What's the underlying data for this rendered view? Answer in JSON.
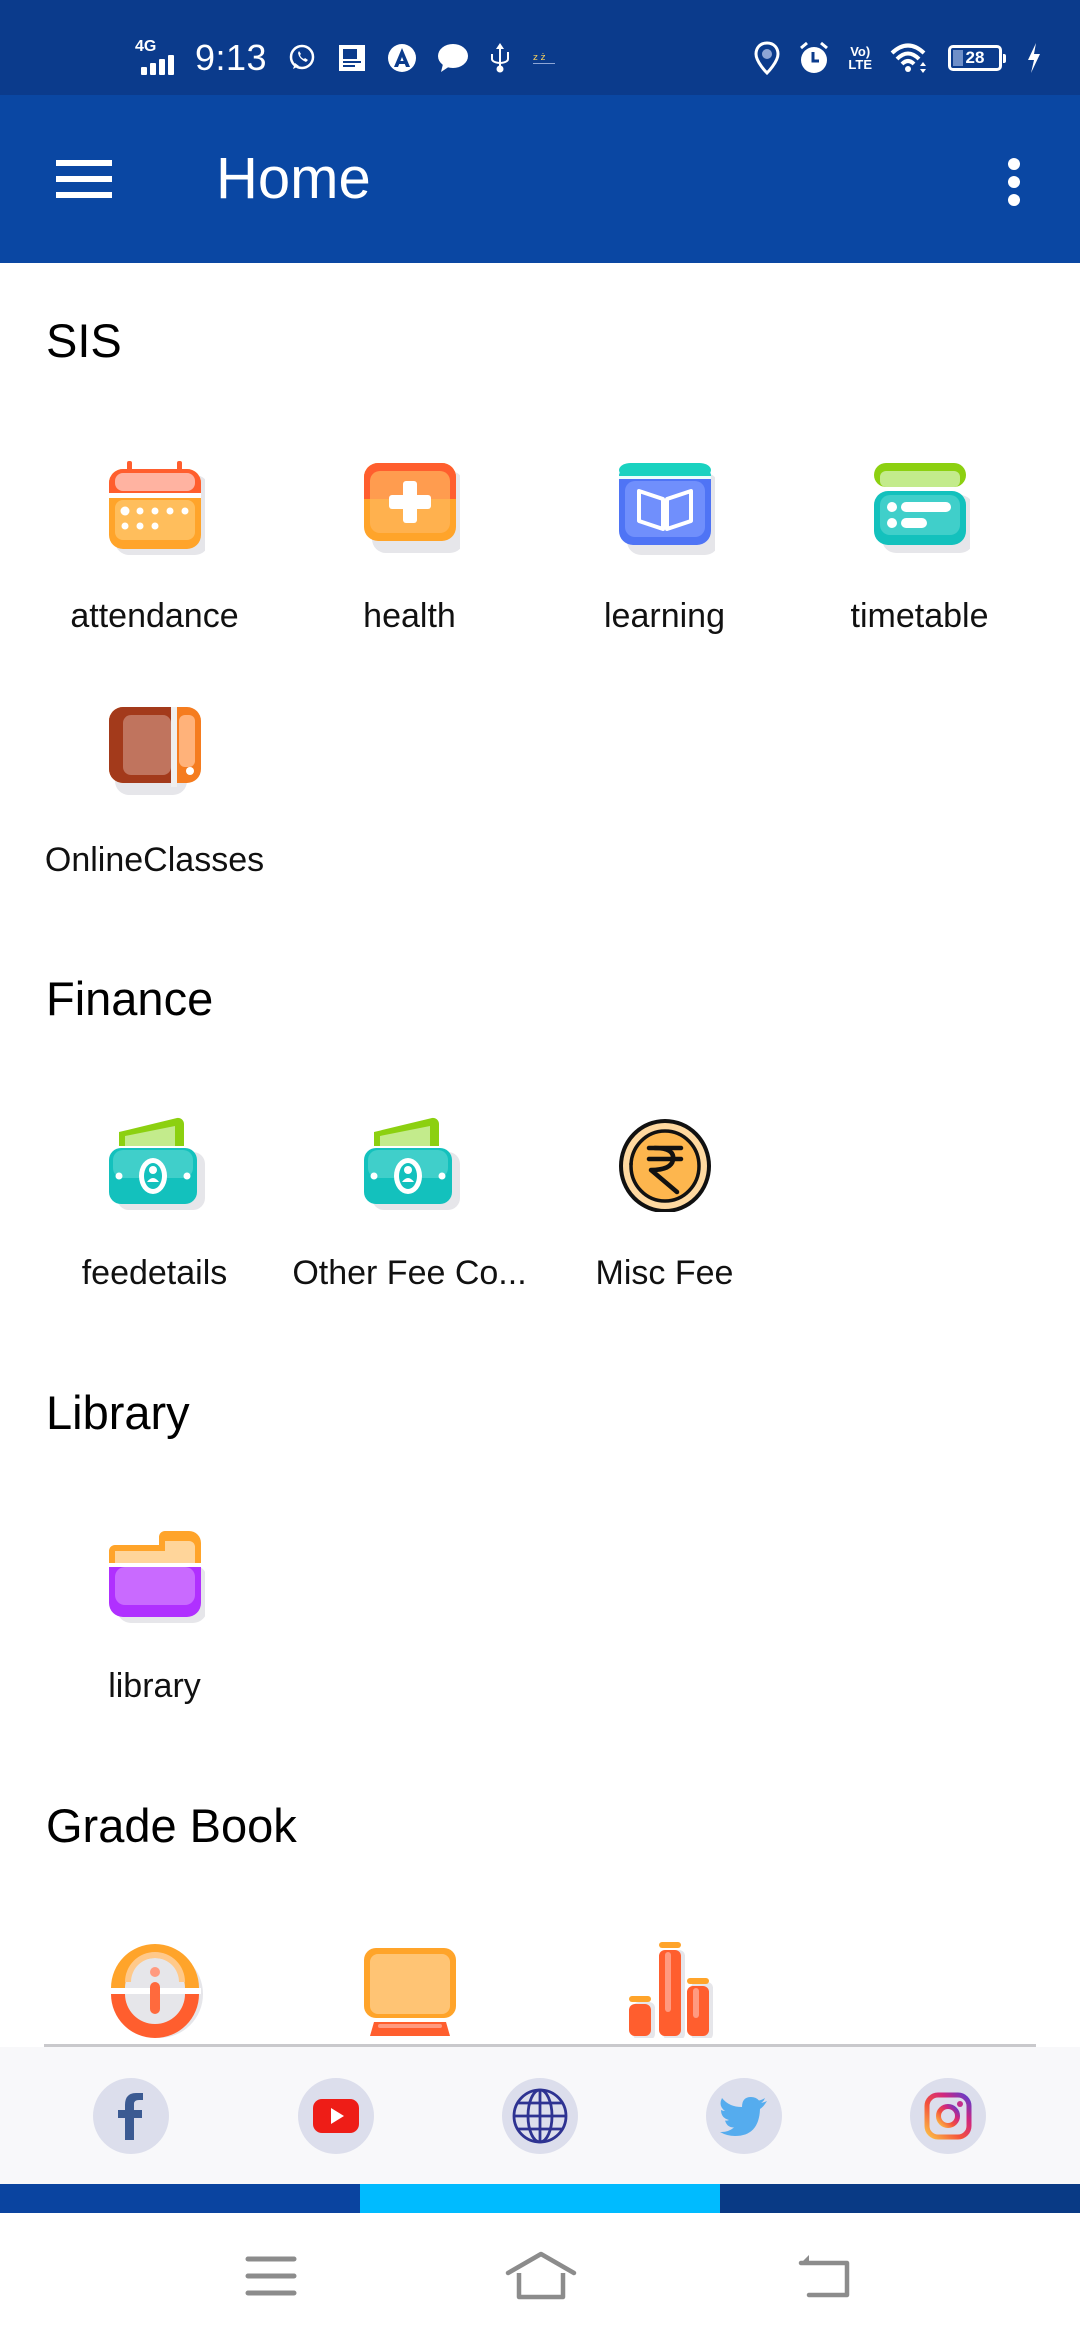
{
  "status_bar": {
    "network": "4G",
    "time": "9:13",
    "battery_level": "28",
    "notification_icons": [
      "whatsapp-icon",
      "document-icon",
      "app-a-icon",
      "message-icon",
      "usb-icon",
      "misc-icon"
    ],
    "system_icons": [
      "location-icon",
      "alarm-icon",
      "volte-icon",
      "wifi-icon",
      "battery-icon",
      "charging-icon"
    ],
    "volte_top": "Vo)",
    "volte_bottom": "LTE"
  },
  "app_bar": {
    "title": "Home",
    "menu_icon": "hamburger-menu-icon",
    "overflow_icon": "more-vert-icon"
  },
  "sections": [
    {
      "title": "SIS",
      "items": [
        {
          "label": "attendance",
          "icon": "calendar-icon"
        },
        {
          "label": "health",
          "icon": "medical-kit-icon"
        },
        {
          "label": "learning",
          "icon": "open-book-icon"
        },
        {
          "label": "timetable",
          "icon": "schedule-list-icon"
        },
        {
          "label": "OnlineClasses",
          "icon": "tablet-icon"
        }
      ]
    },
    {
      "title": "Finance",
      "items": [
        {
          "label": "feedetails",
          "icon": "money-icon"
        },
        {
          "label": "Other Fee Co...",
          "icon": "money-icon"
        },
        {
          "label": "Misc Fee",
          "icon": "rupee-coin-icon"
        }
      ]
    },
    {
      "title": "Library",
      "items": [
        {
          "label": "library",
          "icon": "folder-icon"
        }
      ]
    },
    {
      "title": "Grade Book",
      "items": [
        {
          "label": "",
          "icon": "info-icon"
        },
        {
          "label": "",
          "icon": "monitor-icon"
        },
        {
          "label": "",
          "icon": "bar-chart-icon"
        }
      ]
    }
  ],
  "social_links": [
    {
      "name": "facebook",
      "icon": "facebook-icon"
    },
    {
      "name": "youtube",
      "icon": "youtube-icon"
    },
    {
      "name": "website",
      "icon": "globe-icon"
    },
    {
      "name": "twitter",
      "icon": "twitter-icon"
    },
    {
      "name": "instagram",
      "icon": "instagram-icon"
    }
  ],
  "colors": {
    "status_bar": "#0B3B8C",
    "app_bar": "#0A47A3",
    "strip": [
      "#0A44A0",
      "#00BBFF",
      "#093A85"
    ],
    "social_bg": "#DCDEEC"
  },
  "nav_bar": {
    "buttons": [
      "recents-button",
      "home-button",
      "back-button"
    ]
  }
}
